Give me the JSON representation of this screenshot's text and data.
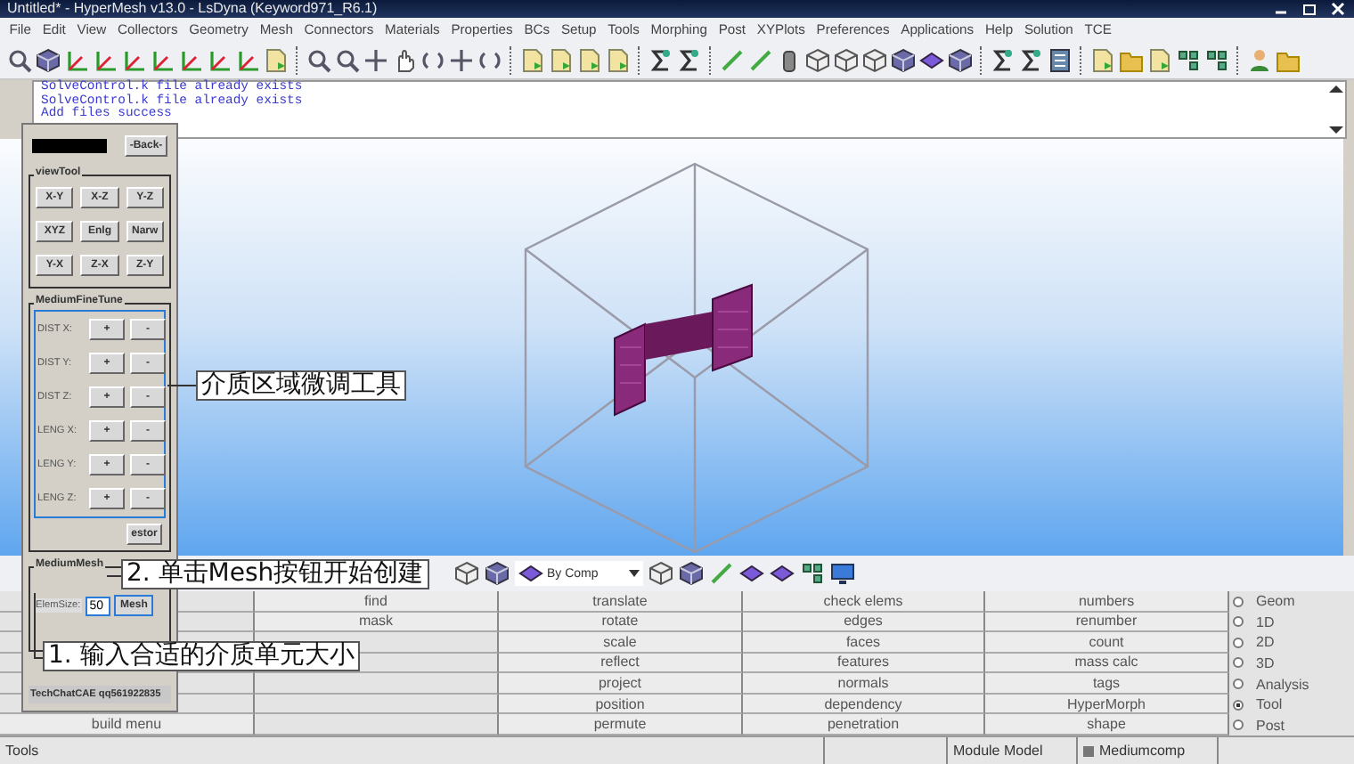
{
  "window": {
    "title": "Untitled* - HyperMesh v13.0 - LsDyna (Keyword971_R6.1)"
  },
  "menu": [
    "File",
    "Edit",
    "View",
    "Collectors",
    "Geometry",
    "Mesh",
    "Connectors",
    "Materials",
    "Properties",
    "BCs",
    "Setup",
    "Tools",
    "Morphing",
    "Post",
    "XYPlots",
    "Preferences",
    "Applications",
    "Help",
    "Solution",
    "TCE"
  ],
  "message_log": [
    "SolveControl.k file already exists",
    "SolveControl.k file already exists",
    "Add files success"
  ],
  "tool_dialog": {
    "back_button": "-Back-",
    "view_tool": {
      "title": "viewTool",
      "buttons": [
        "X-Y",
        "X-Z",
        "Y-Z",
        "XYZ",
        "Enlg",
        "Narw",
        "Y-X",
        "Z-X",
        "Z-Y"
      ]
    },
    "fine_tune": {
      "title": "MediumFineTune",
      "rows": [
        {
          "label": "DIST X:",
          "plus": "+",
          "minus": "-"
        },
        {
          "label": "DIST Y:",
          "plus": "+",
          "minus": "-"
        },
        {
          "label": "DIST Z:",
          "plus": "+",
          "minus": "-"
        },
        {
          "label": "LENG X:",
          "plus": "+",
          "minus": "-"
        },
        {
          "label": "LENG Y:",
          "plus": "+",
          "minus": "-"
        },
        {
          "label": "LENG Z:",
          "plus": "+",
          "minus": "-"
        }
      ],
      "restore_button": "estor"
    },
    "medium_mesh": {
      "title": "MediumMesh",
      "elem_size_label": "ElemSize:",
      "elem_size_value": "50",
      "mesh_button": "Mesh"
    },
    "footer": "TechChatCAE qq561922835"
  },
  "annotations": [
    "介质区域微调工具",
    "2. 单击Mesh按钮开始创建",
    "1. 输入合适的介质单元大小"
  ],
  "display_toolbar": {
    "color_mode": "By Comp"
  },
  "panel": {
    "columns": [
      [
        "build menu"
      ],
      [
        "find",
        "mask"
      ],
      [
        "translate",
        "rotate",
        "scale",
        "reflect",
        "project",
        "position",
        "permute"
      ],
      [
        "check elems",
        "edges",
        "faces",
        "features",
        "normals",
        "dependency",
        "penetration"
      ],
      [
        "numbers",
        "renumber",
        "count",
        "mass calc",
        "tags",
        "HyperMorph",
        "shape"
      ]
    ],
    "modes": [
      {
        "label": "Geom",
        "selected": false
      },
      {
        "label": "1D",
        "selected": false
      },
      {
        "label": "2D",
        "selected": false
      },
      {
        "label": "3D",
        "selected": false
      },
      {
        "label": "Analysis",
        "selected": false
      },
      {
        "label": "Tool",
        "selected": true
      },
      {
        "label": "Post",
        "selected": false
      }
    ]
  },
  "status_bar": {
    "message": "Tools",
    "module": "Module Model",
    "component": "Mediumcomp"
  }
}
